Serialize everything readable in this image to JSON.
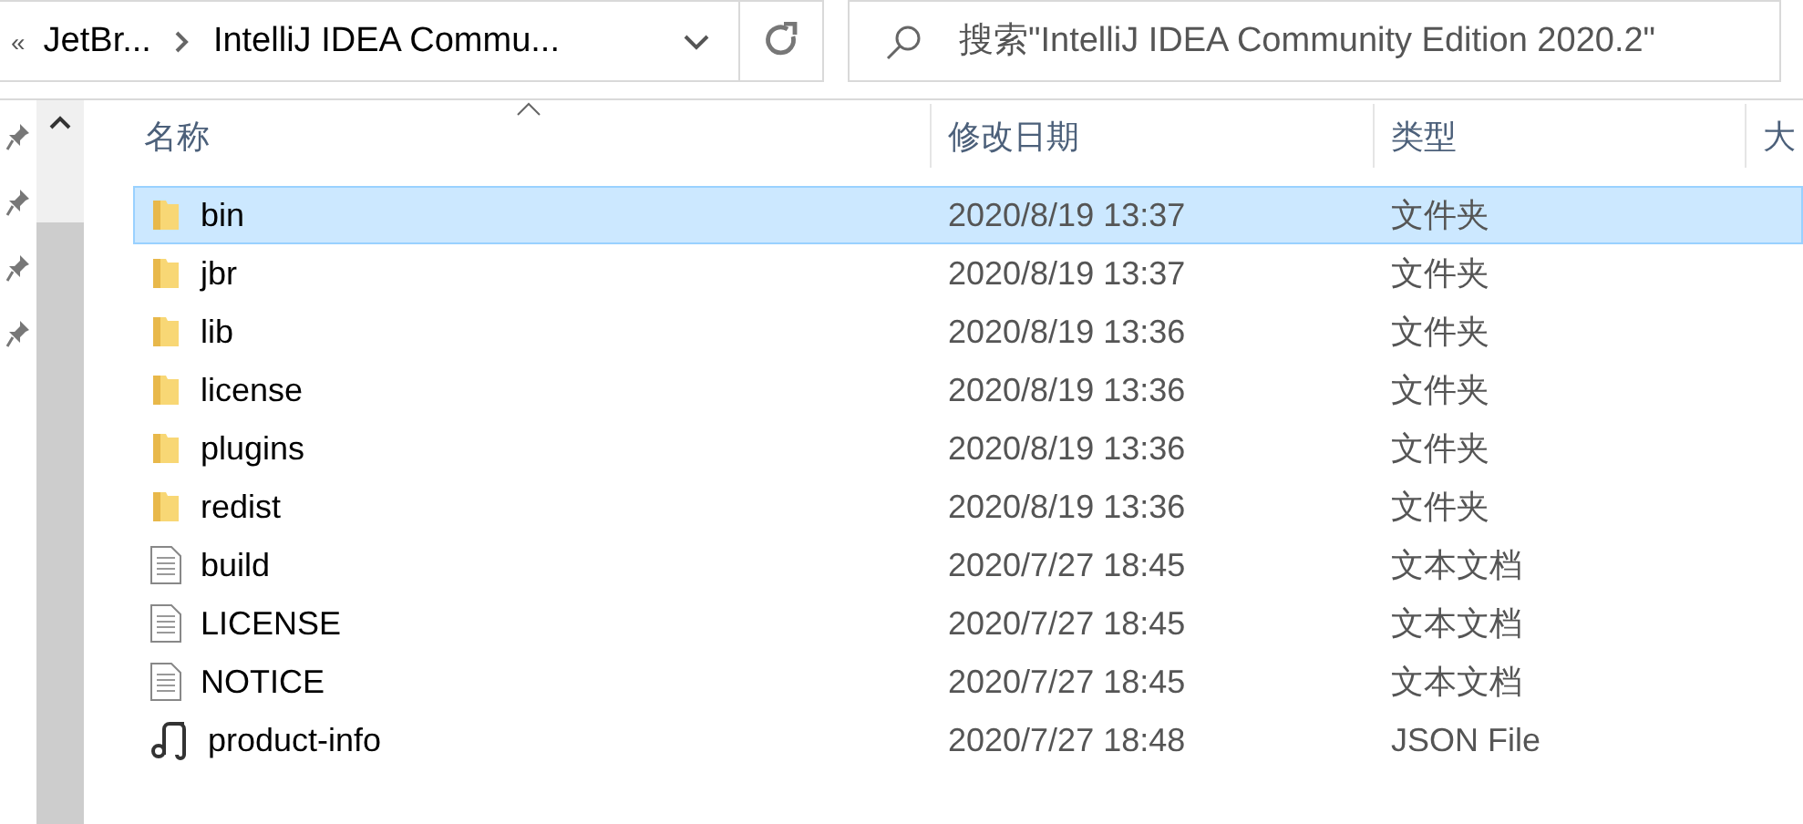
{
  "address_bar": {
    "overflow": "«",
    "crumbs": [
      "JetBr...",
      "IntelliJ IDEA Commu..."
    ]
  },
  "search": {
    "placeholder": "搜索\"IntelliJ IDEA Community Edition 2020.2\""
  },
  "columns": [
    "名称",
    "修改日期",
    "类型",
    "大"
  ],
  "rows": [
    {
      "name": "bin",
      "date": "2020/8/19 13:37",
      "type": "文件夹",
      "kind": "folder",
      "selected": true
    },
    {
      "name": "jbr",
      "date": "2020/8/19 13:37",
      "type": "文件夹",
      "kind": "folder",
      "selected": false
    },
    {
      "name": "lib",
      "date": "2020/8/19 13:36",
      "type": "文件夹",
      "kind": "folder",
      "selected": false
    },
    {
      "name": "license",
      "date": "2020/8/19 13:36",
      "type": "文件夹",
      "kind": "folder",
      "selected": false
    },
    {
      "name": "plugins",
      "date": "2020/8/19 13:36",
      "type": "文件夹",
      "kind": "folder",
      "selected": false
    },
    {
      "name": "redist",
      "date": "2020/8/19 13:36",
      "type": "文件夹",
      "kind": "folder",
      "selected": false
    },
    {
      "name": "build",
      "date": "2020/7/27 18:45",
      "type": "文本文档",
      "kind": "text",
      "selected": false
    },
    {
      "name": "LICENSE",
      "date": "2020/7/27 18:45",
      "type": "文本文档",
      "kind": "text",
      "selected": false
    },
    {
      "name": "NOTICE",
      "date": "2020/7/27 18:45",
      "type": "文本文档",
      "kind": "text",
      "selected": false
    },
    {
      "name": "product-info",
      "date": "2020/7/27 18:48",
      "type": "JSON File",
      "kind": "json",
      "selected": false
    }
  ]
}
